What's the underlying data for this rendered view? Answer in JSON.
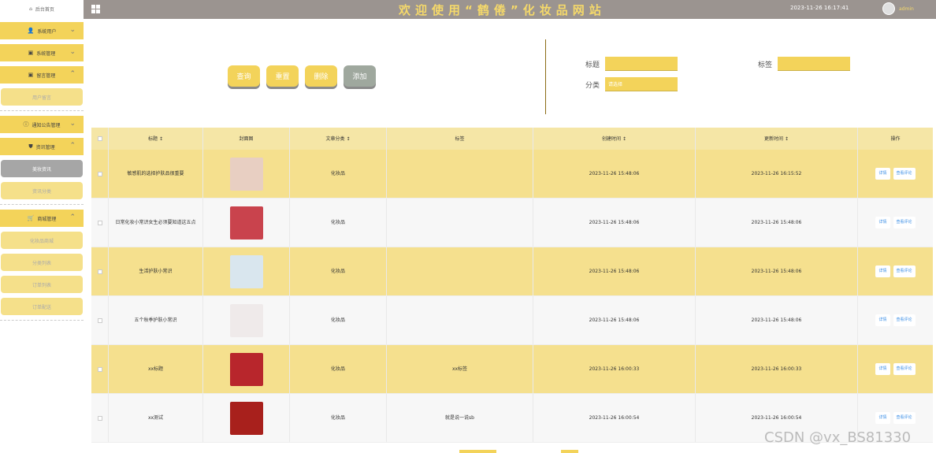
{
  "header": {
    "site_title": "欢迎使用“鹤倦”化妆品网站",
    "datetime": "2023-11-26 16:17:41",
    "username": "admin"
  },
  "sidebar": {
    "home": "后台首页",
    "groups": [
      {
        "label": "系统用户",
        "expanded": false
      },
      {
        "label": "系统管理",
        "expanded": false
      },
      {
        "label": "留言管理",
        "expanded": true,
        "subs": [
          "用户留言"
        ]
      },
      {
        "label": "通知公告管理",
        "expanded": false
      },
      {
        "label": "资讯管理",
        "expanded": true,
        "subs": [
          "美妆资讯",
          "资讯分类"
        ]
      },
      {
        "label": "商城管理",
        "expanded": true,
        "subs": [
          "化妆品商城",
          "分类列表",
          "订单列表",
          "订单配送"
        ]
      }
    ],
    "active_sub": "美妆资讯"
  },
  "toolbar": {
    "query": "查询",
    "reset": "重置",
    "delete": "删除",
    "add": "添加"
  },
  "filters": {
    "title_label": "标题",
    "title_value": "",
    "tag_label": "标签",
    "tag_value": "",
    "category_label": "分类",
    "category_value": "请选择"
  },
  "table": {
    "headers": [
      "标题 ↕",
      "封面图",
      "文章分类 ↕",
      "标签",
      "创建时间 ↕",
      "更新时间 ↕",
      "操作"
    ],
    "rows": [
      {
        "title": "敏感肌的选择护肤品很重要",
        "category": "化妆品",
        "tag": "",
        "created": "2023-11-26 15:48:06",
        "updated": "2023-11-26 16:15:52",
        "thumb_color": "#e8cfc2"
      },
      {
        "title": "日常化妆小常识女生必须要知道这五点",
        "category": "化妆品",
        "tag": "",
        "created": "2023-11-26 15:48:06",
        "updated": "2023-11-26 15:48:06",
        "thumb_color": "#c9434d"
      },
      {
        "title": "生活护肤小常识",
        "category": "化妆品",
        "tag": "",
        "created": "2023-11-26 15:48:06",
        "updated": "2023-11-26 15:48:06",
        "thumb_color": "#d9e6ee"
      },
      {
        "title": "五个秋季护肤小常识",
        "category": "化妆品",
        "tag": "",
        "created": "2023-11-26 15:48:06",
        "updated": "2023-11-26 15:48:06",
        "thumb_color": "#efeaea"
      },
      {
        "title": "xx标题",
        "category": "化妆品",
        "tag": "xx标签",
        "created": "2023-11-26 16:00:33",
        "updated": "2023-11-26 16:00:33",
        "thumb_color": "#b8262c"
      },
      {
        "title": "xx测试",
        "category": "化妆品",
        "tag": "就是说一说sb",
        "created": "2023-11-26 16:00:54",
        "updated": "2023-11-26 16:00:54",
        "thumb_color": "#a8201c"
      }
    ],
    "op_detail": "详情",
    "op_comments": "查看评论"
  },
  "watermark": "CSDN @vx_BS81330",
  "colors": {
    "accent": "#f3d35a",
    "header": "#9b9490"
  }
}
